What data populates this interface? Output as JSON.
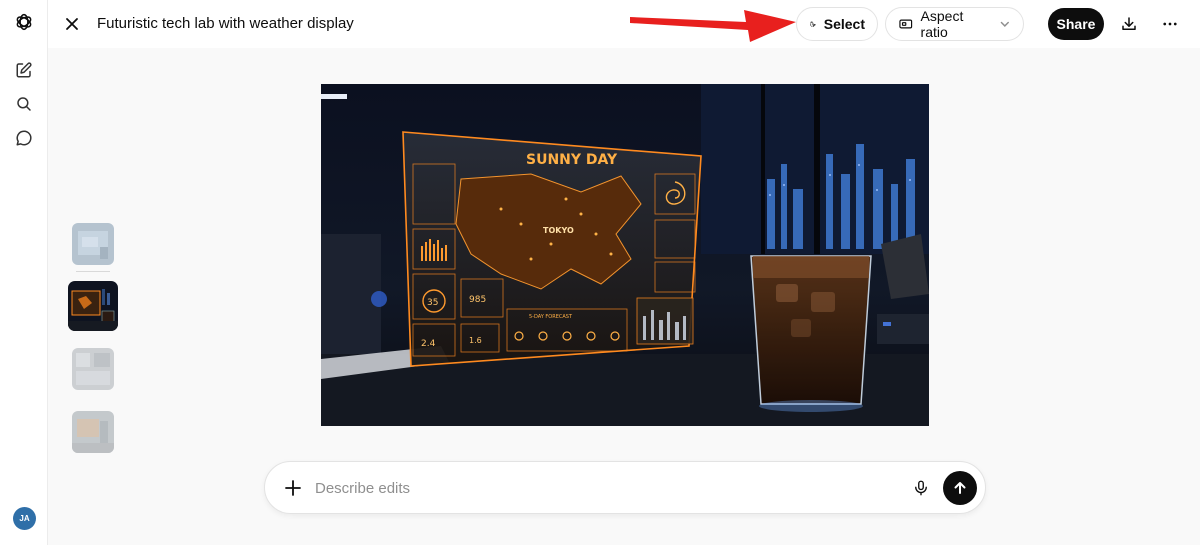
{
  "header": {
    "title": "Futuristic tech lab with weather display",
    "select_label": "Select",
    "aspect_ratio_label": "Aspect ratio",
    "share_label": "Share"
  },
  "sidebar": {
    "avatar_initials": "JA",
    "items": [
      {
        "icon": "new-chat-icon"
      },
      {
        "icon": "search-icon"
      },
      {
        "icon": "chat-bubble-icon"
      }
    ]
  },
  "image": {
    "hud_title": "SUNNY DAY",
    "hud_city": "TOKYO",
    "hud_forecast_label": "5-DAY FORECAST",
    "hud_gauge_value": "35",
    "hud_pressure_value": "985",
    "hud_rain_value": "2.4",
    "hud_small_value": "1.6"
  },
  "thumbnails": [
    {
      "active": false
    },
    {
      "active": true
    },
    {
      "active": false
    },
    {
      "active": false
    }
  ],
  "composer": {
    "placeholder": "Describe edits"
  },
  "colors": {
    "annotation_arrow": "#e8201e",
    "hud_orange": "#ff8a1f",
    "primary_button": "#0d0d0d",
    "avatar": "#2f6fa8"
  }
}
